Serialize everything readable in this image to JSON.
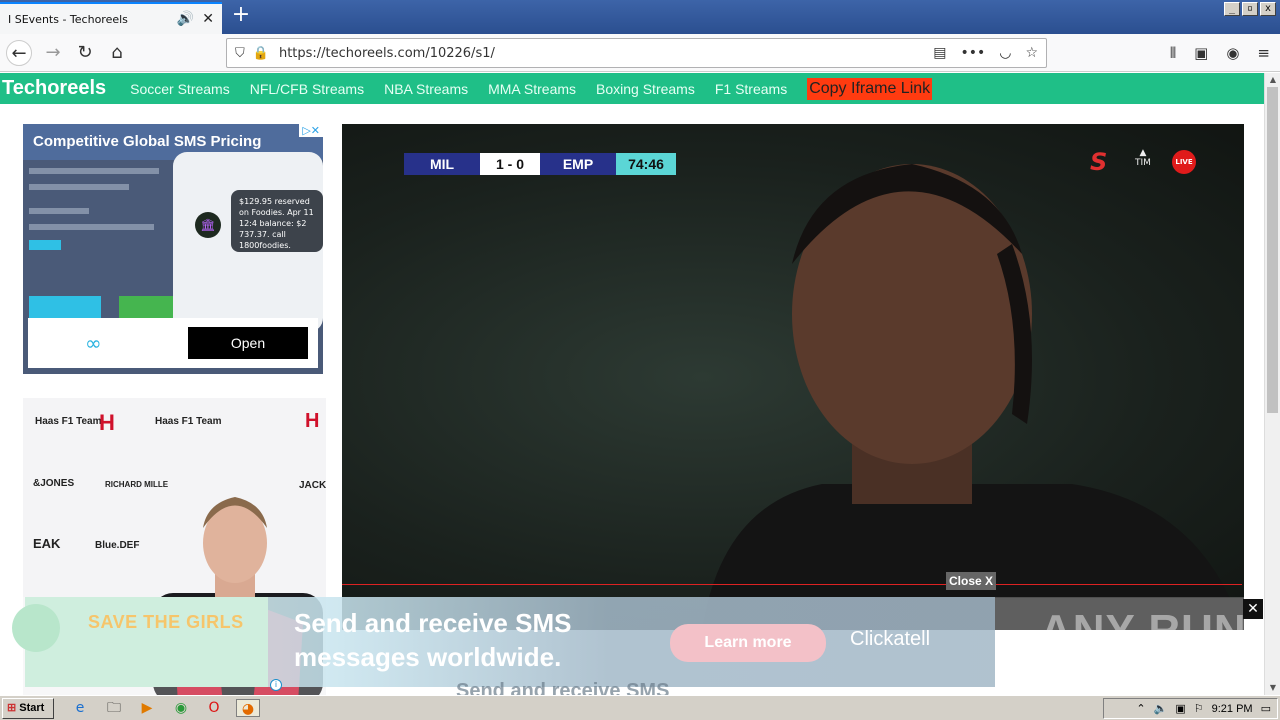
{
  "browser": {
    "tab_title": "I SEvents - Techoreels",
    "url": "https://techoreels.com/10226/s1/"
  },
  "site": {
    "brand": "Techoreels",
    "nav": [
      "Soccer Streams",
      "NFL/CFB Streams",
      "NBA Streams",
      "MMA Streams",
      "Boxing Streams",
      "F1 Streams"
    ],
    "copy_link": "Copy Iframe Link"
  },
  "left_ad": {
    "headline": "Competitive Global SMS Pricing",
    "bubble": "$129.95 reserved on Foodies. Apr 11 12:4 balance: $2 737.37. call 1800foodies.",
    "open_label": "Open"
  },
  "haas_image": {
    "sponsors": [
      "Haas F1 Team",
      "Haas F1 Team",
      "&JONES",
      "RICHARD MILLE",
      "JACK",
      "EAK",
      "Blue.DEF"
    ]
  },
  "video": {
    "home": "MIL",
    "score": "1 - 0",
    "away": "EMP",
    "clock": "74:46",
    "live_badge": "LIVE",
    "close_label": "Close X"
  },
  "bottom_ad": {
    "left_title": "SAVE THE GIRLS",
    "line1": "Send and receive SMS",
    "line2": "messages worldwide.",
    "cta": "Learn more",
    "brand": "Clickatell",
    "ghost": "Send and receive SMS"
  },
  "watermark": "ANY RUN",
  "taskbar": {
    "start": "Start",
    "time": "9:21 PM"
  }
}
